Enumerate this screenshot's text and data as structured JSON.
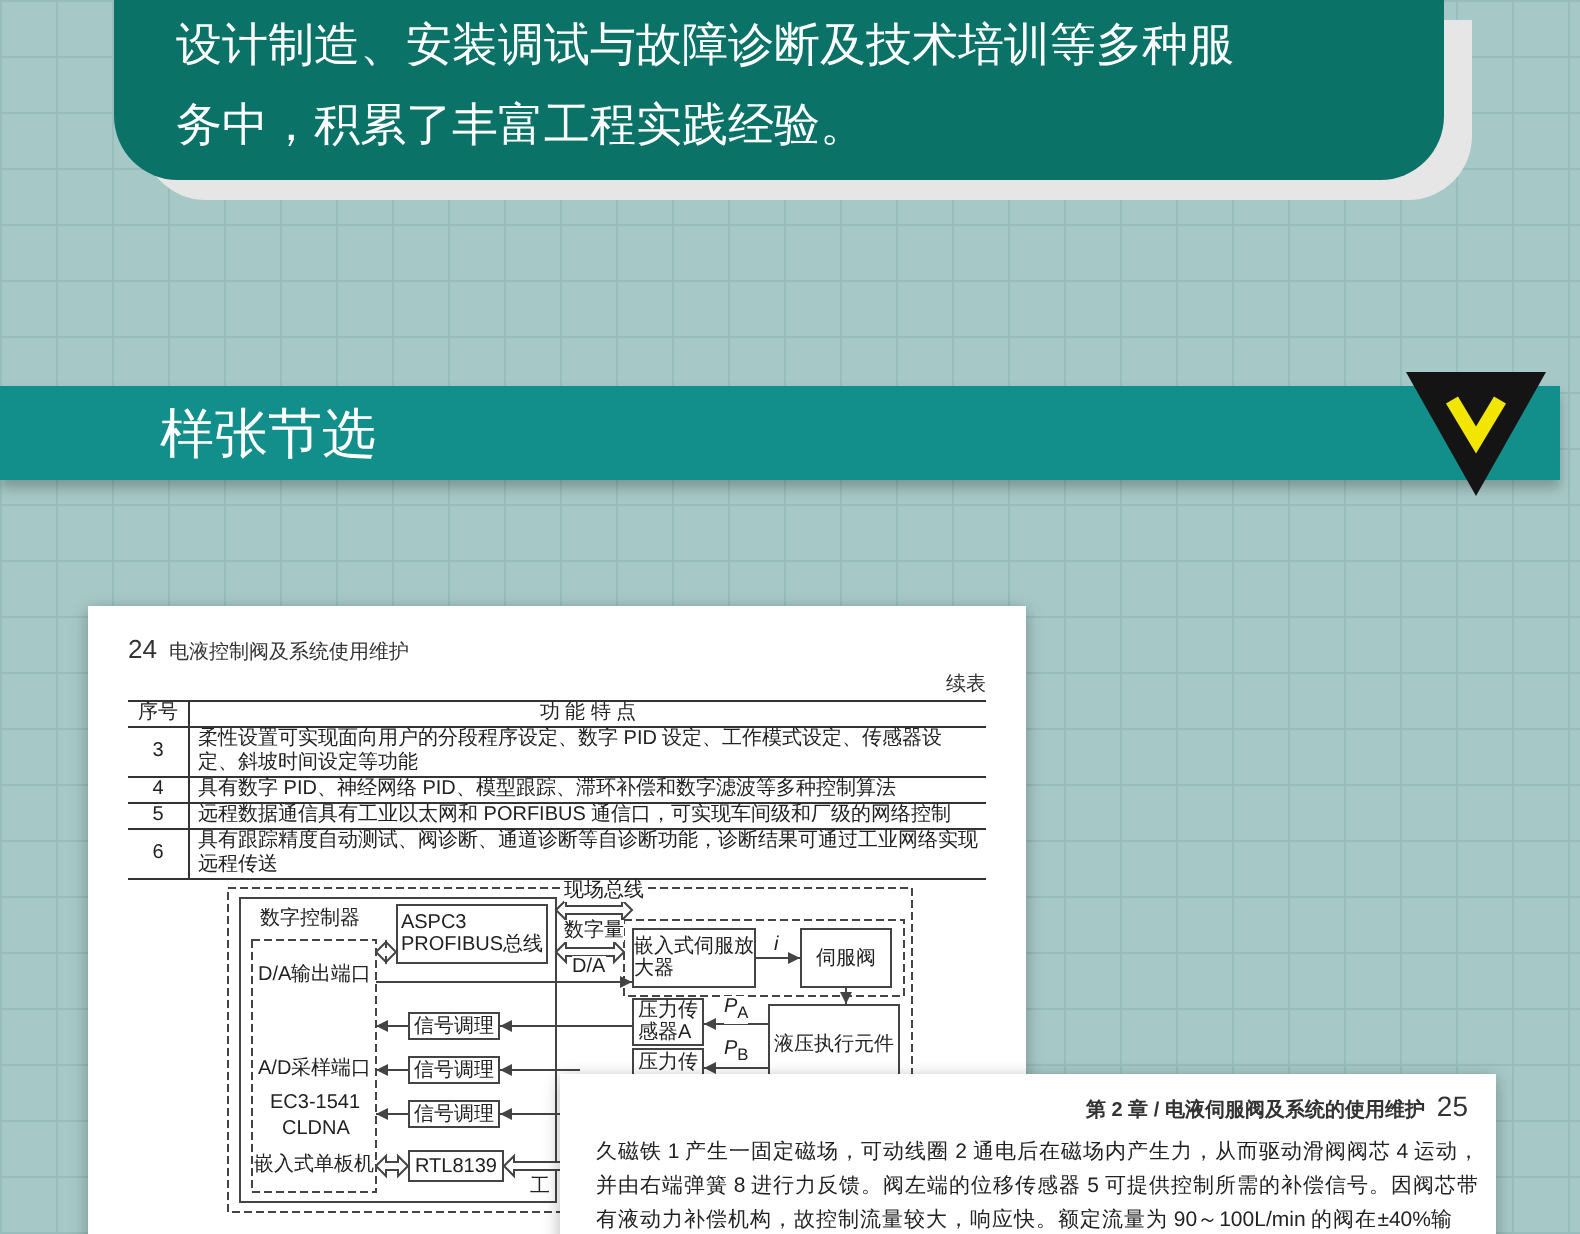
{
  "intro_card": {
    "lines": [
      "设计制造、安装调试与故障诊断及技术培训等多种服",
      "务中，积累了丰富工程实践经验。"
    ]
  },
  "section_banner": {
    "title": "样张节选"
  },
  "left_page": {
    "page_number": "24",
    "running_title": "电液控制阀及系统使用维护",
    "table_caption": "续表",
    "table": {
      "columns": [
        "序号",
        "功 能 特 点"
      ],
      "rows": [
        {
          "cells": [
            "3",
            "柔性设置可实现面向用户的分段程序设定、数字 PID 设定、工作模式设定、传感器设定、斜坡时间设定等功能"
          ]
        },
        {
          "cells": [
            "4",
            "具有数字 PID、神经网络 PID、模型跟踪、滞环补偿和数字滤波等多种控制算法"
          ]
        },
        {
          "cells": [
            "5",
            "远程数据通信具有工业以太网和 PORFIBUS 通信口，可实现车间级和厂级的网络控制"
          ]
        },
        {
          "cells": [
            "6",
            "具有跟踪精度自动测试、阀诊断、通道诊断等自诊断功能，诊断结果可通过工业网络实现远程传送"
          ]
        }
      ]
    },
    "diagram": {
      "blocks": [
        {
          "lines": [
            "ASPC3",
            "PROFIBUS总线"
          ]
        },
        {
          "lines": [
            "嵌入式伺服放",
            "大器"
          ]
        },
        {
          "lines": [
            "伺服阀"
          ]
        },
        {
          "lines": [
            "信号调理"
          ]
        },
        {
          "lines": [
            "压力传",
            "感器A"
          ]
        },
        {
          "lines": [
            "液压执行元件"
          ]
        },
        {
          "lines": [
            "压力传"
          ]
        },
        {
          "lines": [
            "信号调理"
          ]
        },
        {
          "lines": [
            "信号调理"
          ]
        },
        {
          "lines": [
            "RTL8139"
          ]
        }
      ],
      "labels": [
        "现场总线",
        "数字控制器",
        "数字量",
        "*i*",
        "D/A",
        "D/A输出端口",
        "*P*$_{A}$",
        "*P*$_{B}$",
        "A/D采样端口",
        "EC3-1541",
        "CLDNA",
        "嵌入式单板机",
        "工"
      ]
    }
  },
  "right_page": {
    "running_title": "第 2 章 / 电液伺服阀及系统的使用维护",
    "page_number": "25",
    "body_lines": [
      "久磁铁 1 产生一固定磁场，可动线圈 2 通电后在磁场内产生力，从而驱动滑阀阀芯 4 运动，",
      "并由右端弹簧 8 进行力反馈。阀左端的位移传感器 5 可提供控制所需的补偿信号。因阀芯带",
      "有液动力补偿机构，故控制流量较大，响应快。额定流量为 90～100L/min 的阀在±40%输"
    ]
  }
}
